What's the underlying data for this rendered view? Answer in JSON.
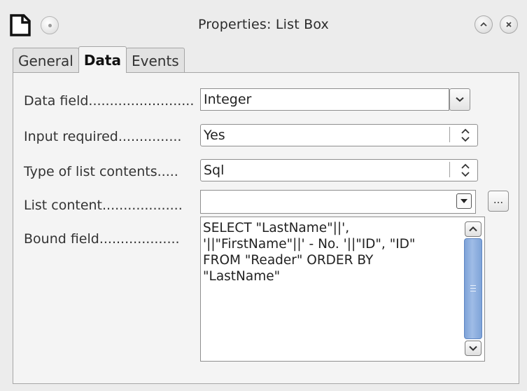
{
  "window": {
    "title": "Properties: List Box",
    "icons": {
      "app": "document-icon",
      "menu": "window-menu-icon",
      "roll": "chevron-up-icon",
      "close": "close-icon"
    }
  },
  "tabs": [
    {
      "label": "General",
      "active": false
    },
    {
      "label": "Data",
      "active": true
    },
    {
      "label": "Events",
      "active": false
    }
  ],
  "form": {
    "data_field": {
      "label": "Data field.........................",
      "value": "Integer"
    },
    "input_required": {
      "label": "Input required...............",
      "value": "Yes"
    },
    "list_type": {
      "label": "Type of list contents.....",
      "value": "Sql"
    },
    "list_content": {
      "label": "List content...................",
      "value": "",
      "more_button": "..."
    },
    "bound_field": {
      "label": "Bound field...................",
      "lines": [
        "SELECT \"LastName\"||',",
        "'||\"FirstName\"||' - No. '||\"ID\", \"ID\"",
        "FROM \"Reader\" ORDER BY",
        "\"LastName\""
      ]
    }
  },
  "colors": {
    "scroll_thumb": "#8fb0df",
    "background": "#ececec"
  }
}
